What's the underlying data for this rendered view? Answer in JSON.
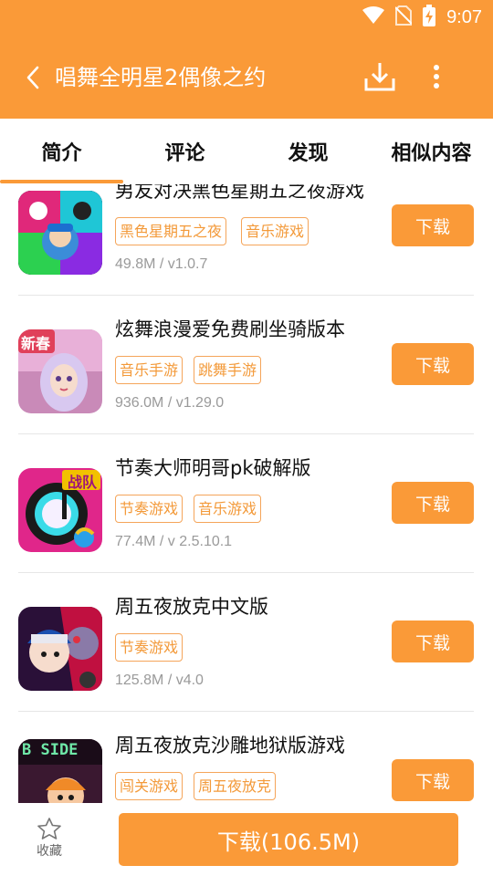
{
  "status_bar": {
    "time": "9:07",
    "icons": [
      "wifi-icon",
      "no-sim-icon",
      "battery-charging-icon"
    ]
  },
  "app_bar": {
    "back_icon": "chevron-left-icon",
    "title": "唱舞全明星2偶像之约",
    "download_icon": "download-icon",
    "more_icon": "more-vertical-icon"
  },
  "tabs": [
    {
      "label": "简介",
      "selected": true
    },
    {
      "label": "评论",
      "selected": false
    },
    {
      "label": "发现",
      "selected": false
    },
    {
      "label": "相似内容",
      "selected": false
    }
  ],
  "colors": {
    "accent": "#fa9a38",
    "tag_text": "#f39a3a",
    "meta_text": "#9a9a9a"
  },
  "items": [
    {
      "title": "男友对决黑色星期五之夜游戏",
      "tags": [
        "黑色星期五之夜",
        "音乐游戏"
      ],
      "meta": "49.8M / v1.0.7",
      "button": "下载"
    },
    {
      "title": "炫舞浪漫爱免费刷坐骑版本",
      "tags": [
        "音乐手游",
        "跳舞手游"
      ],
      "meta": "936.0M / v1.29.0",
      "button": "下载",
      "icon_text": "新春"
    },
    {
      "title": "节奏大师明哥pk破解版",
      "tags": [
        "节奏游戏",
        "音乐游戏"
      ],
      "meta": "77.4M / v 2.5.10.1",
      "button": "下载",
      "icon_text": "战队"
    },
    {
      "title": "周五夜放克中文版",
      "tags": [
        "节奏游戏"
      ],
      "meta": "125.8M / v4.0",
      "button": "下载"
    },
    {
      "title": "周五夜放克沙雕地狱版游戏",
      "tags": [
        "闯关游戏",
        "周五夜放克"
      ],
      "meta": "",
      "button": "下载",
      "icon_text": "B SIDE"
    }
  ],
  "bottom_bar": {
    "favorite_label": "收藏",
    "download_label": "下载(106.5M)"
  }
}
